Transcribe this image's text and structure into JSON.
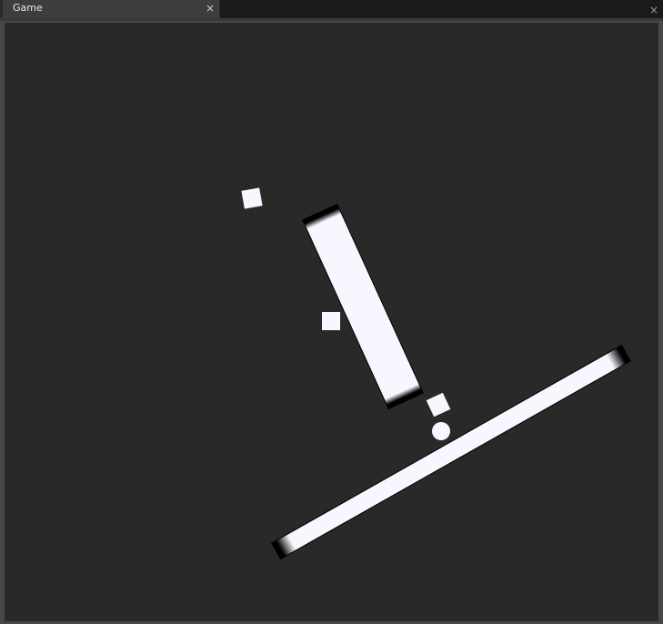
{
  "tab": {
    "title": "Game"
  },
  "colors": {
    "viewport_background": "#292929",
    "object_fill": "#f7f8ff",
    "object_edge": "#000000"
  },
  "scene": {
    "objects": [
      {
        "name": "falling-box-1",
        "kind": "box"
      },
      {
        "name": "falling-box-2",
        "kind": "box"
      },
      {
        "name": "falling-box-3",
        "kind": "box"
      },
      {
        "name": "falling-ball",
        "kind": "ball"
      },
      {
        "name": "tilted-plank",
        "kind": "plank"
      },
      {
        "name": "ground-ramp",
        "kind": "plank"
      }
    ]
  }
}
